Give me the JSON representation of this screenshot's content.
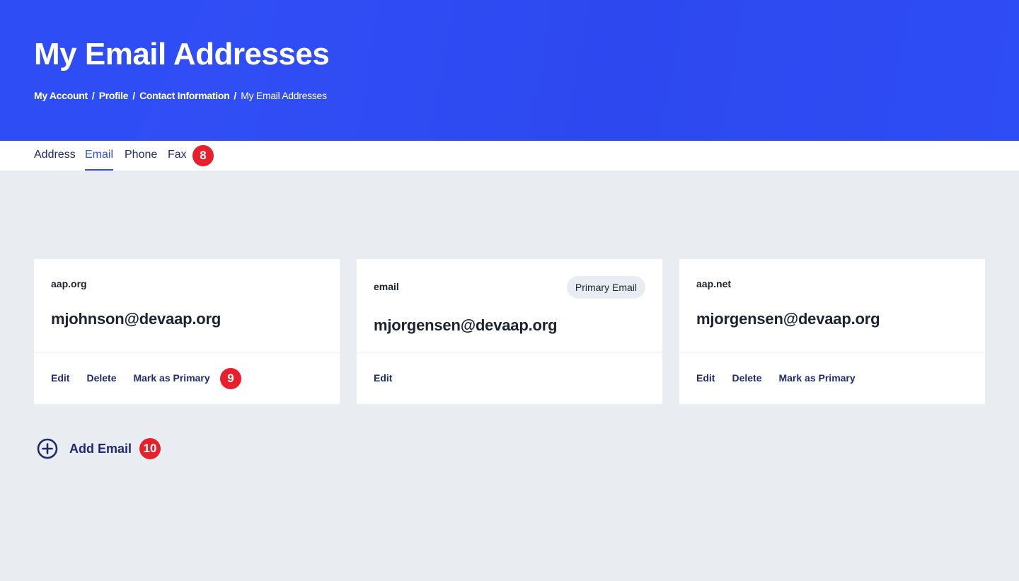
{
  "header": {
    "title": "My Email Addresses",
    "breadcrumb": {
      "links": [
        "My Account",
        "Profile",
        "Contact Information"
      ],
      "separator": "/",
      "current": "My Email Addresses"
    }
  },
  "tabs": {
    "items": [
      {
        "label": "Address"
      },
      {
        "label": "Email",
        "active": true
      },
      {
        "label": "Phone"
      },
      {
        "label": "Fax"
      }
    ]
  },
  "annotations": {
    "tabs_marker": "8",
    "actions_marker": "9",
    "add_marker": "10"
  },
  "cards": [
    {
      "type": "aap.org",
      "email": "mjohnson@devaap.org",
      "actions": [
        "Edit",
        "Delete",
        "Mark as Primary"
      ]
    },
    {
      "type": "email",
      "email": "mjorgensen@devaap.org",
      "badge": "Primary Email",
      "actions": [
        "Edit"
      ]
    },
    {
      "type": "aap.net",
      "email": "mjorgensen@devaap.org",
      "actions": [
        "Edit",
        "Delete",
        "Mark as Primary"
      ]
    }
  ],
  "add_email": {
    "label": "Add Email",
    "icon": "plus-circle-icon"
  },
  "colors": {
    "header_blue": "#2f4df5",
    "navy_text": "#1f2b6e",
    "marker_red": "#e8202c",
    "page_bg": "#e9edf1"
  }
}
